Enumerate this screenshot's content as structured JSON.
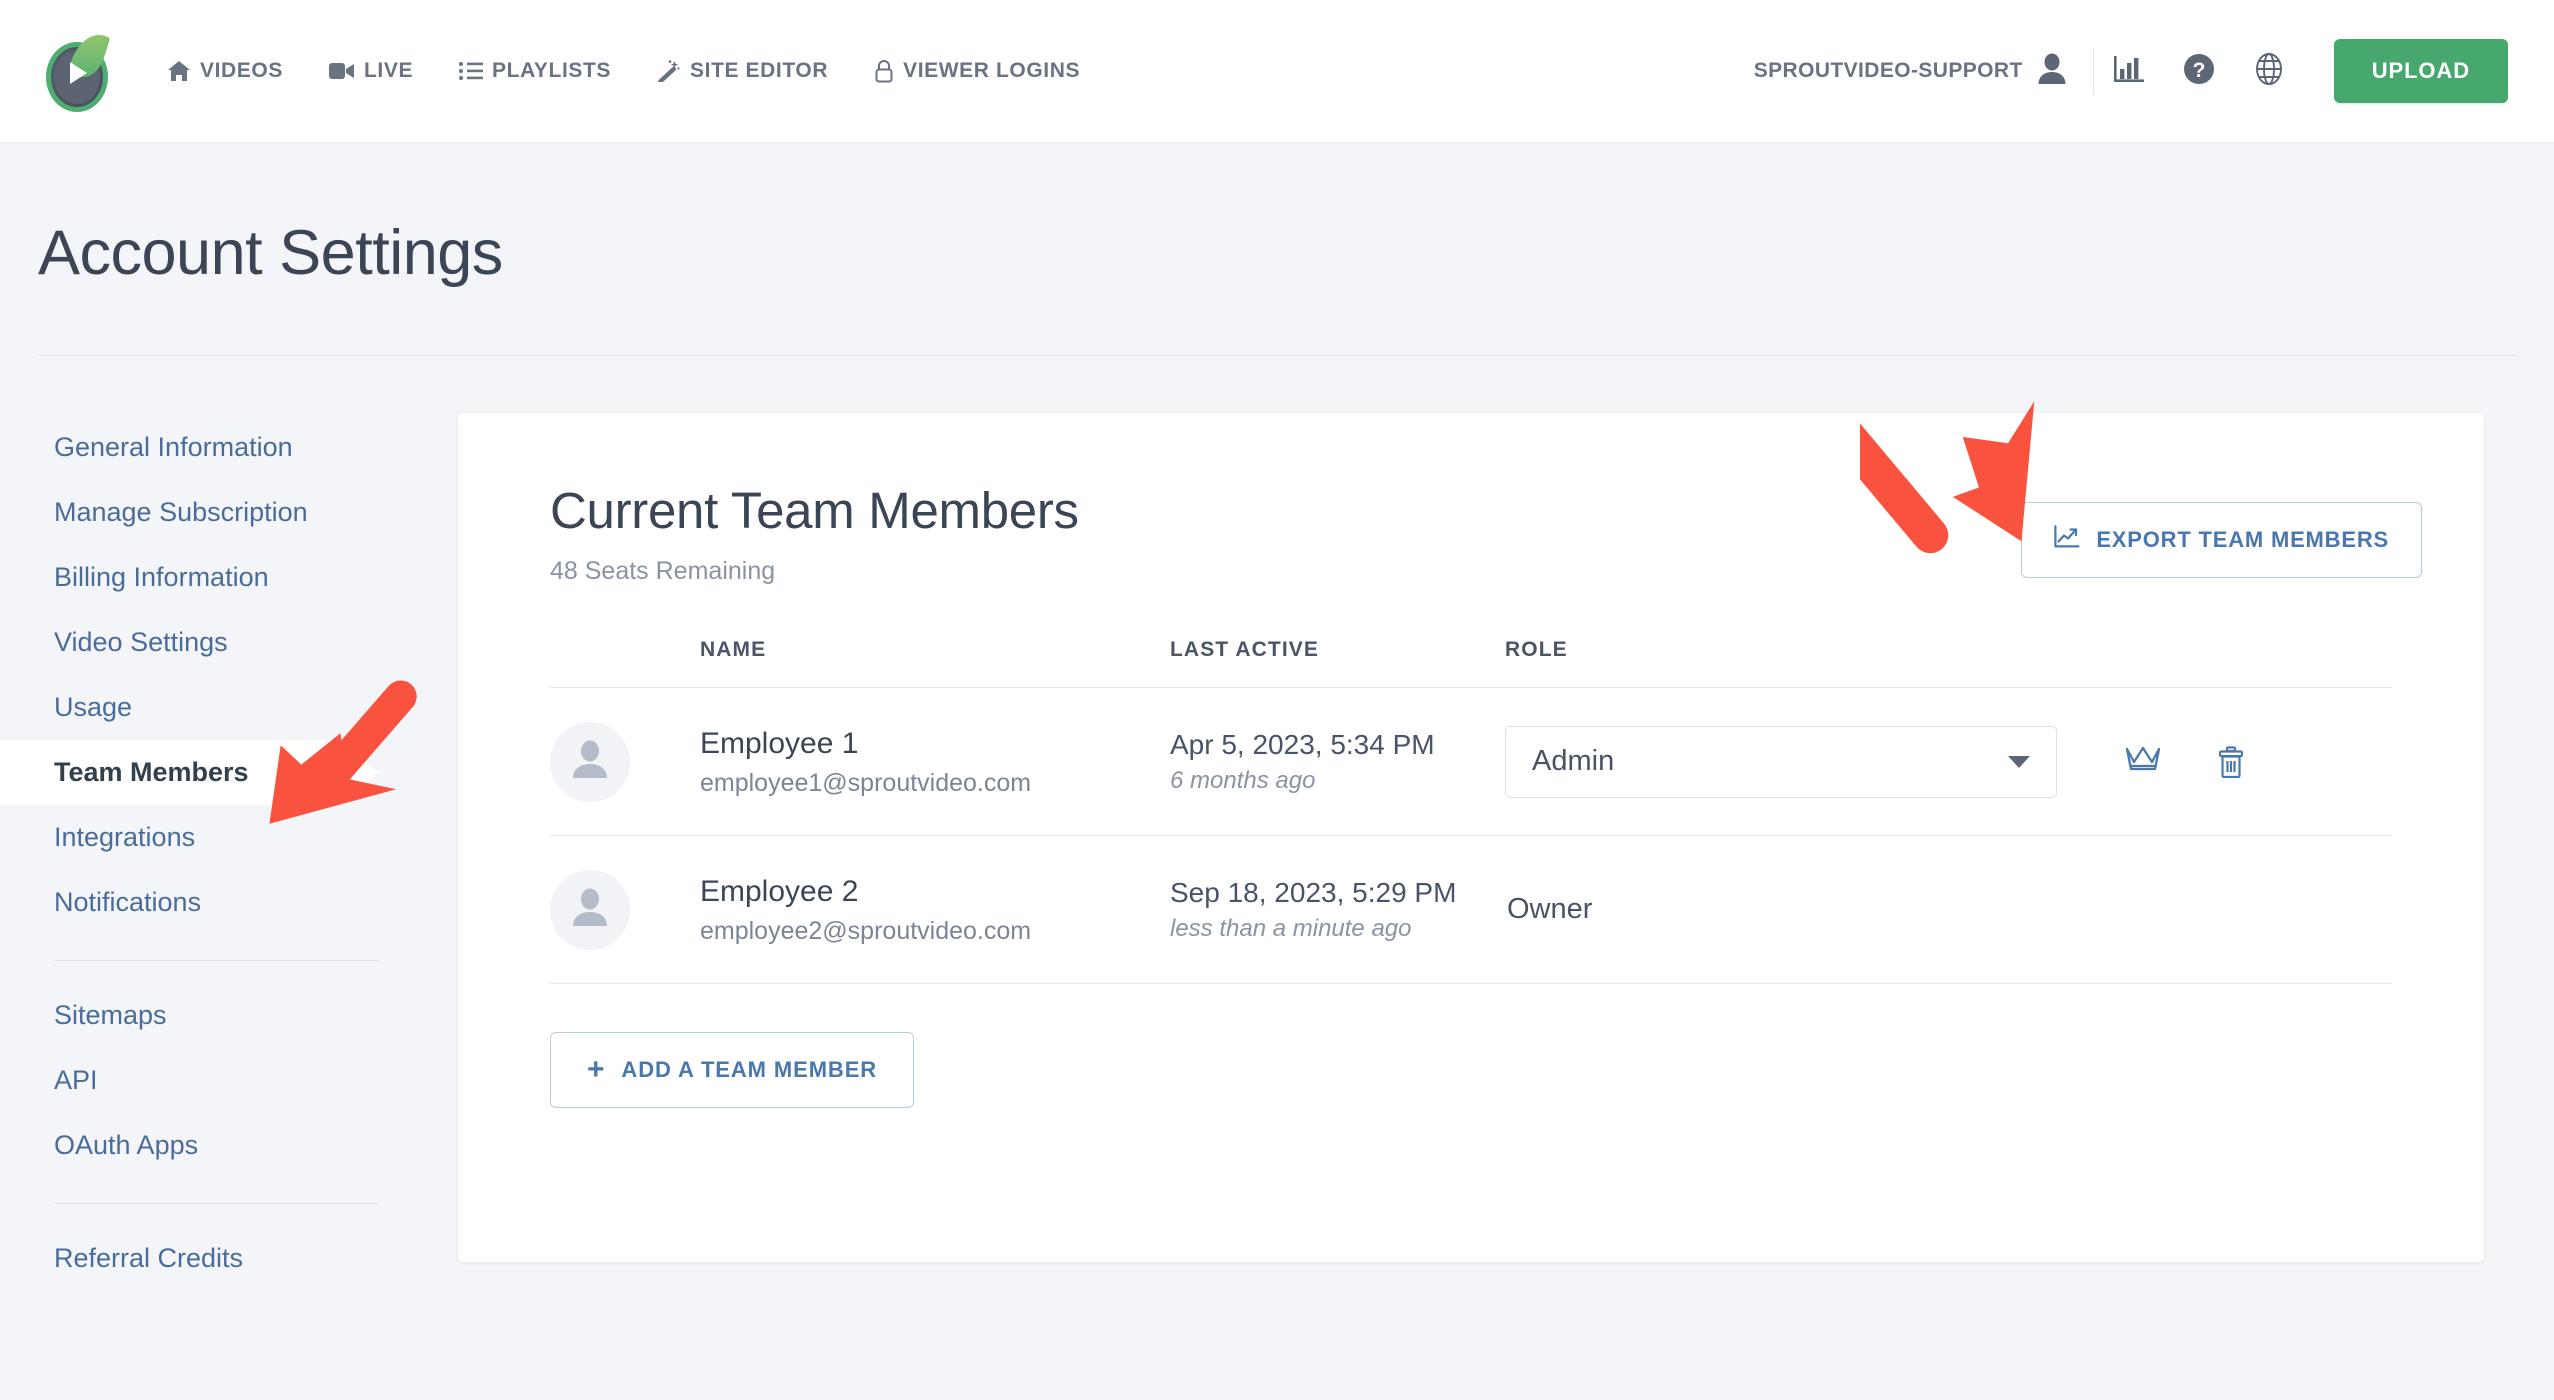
{
  "topnav": {
    "logo_name": "sproutvideo-logo",
    "links": [
      {
        "label": "VIDEOS",
        "icon": "home-icon"
      },
      {
        "label": "LIVE",
        "icon": "video-camera-icon"
      },
      {
        "label": "PLAYLISTS",
        "icon": "list-icon"
      },
      {
        "label": "SITE EDITOR",
        "icon": "magic-wand-icon"
      },
      {
        "label": "VIEWER LOGINS",
        "icon": "lock-icon"
      }
    ],
    "account_name": "SPROUTVIDEO-SUPPORT",
    "account_icon": "user-icon",
    "analytics_icon": "bar-chart-icon",
    "help_icon": "question-circle-icon",
    "globe_icon": "globe-icon",
    "upload_label": "UPLOAD",
    "upload_color": "#46a86d"
  },
  "page": {
    "title": "Account Settings"
  },
  "sidebar": {
    "groups": [
      {
        "items": [
          {
            "label": "General Information",
            "active": false
          },
          {
            "label": "Manage Subscription",
            "active": false
          },
          {
            "label": "Billing Information",
            "active": false
          },
          {
            "label": "Video Settings",
            "active": false
          },
          {
            "label": "Usage",
            "active": false
          },
          {
            "label": "Team Members",
            "active": true
          },
          {
            "label": "Integrations",
            "active": false
          },
          {
            "label": "Notifications",
            "active": false
          }
        ]
      },
      {
        "items": [
          {
            "label": "Sitemaps",
            "active": false
          },
          {
            "label": "API",
            "active": false
          },
          {
            "label": "OAuth Apps",
            "active": false
          }
        ]
      },
      {
        "items": [
          {
            "label": "Referral Credits",
            "active": false
          }
        ]
      }
    ]
  },
  "card": {
    "title": "Current Team Members",
    "subtitle": "48 Seats Remaining",
    "export_label": "EXPORT TEAM MEMBERS",
    "export_icon": "line-chart-icon",
    "add_label": "ADD A TEAM MEMBER",
    "add_icon": "plus-icon",
    "columns": [
      "NAME",
      "LAST ACTIVE",
      "ROLE"
    ],
    "rows": [
      {
        "avatar_icon": "user-placeholder-icon",
        "name": "Employee 1",
        "email": "employee1@sproutvideo.com",
        "last_active": "Apr 5, 2023, 5:34 PM",
        "last_active_relative": "6 months ago",
        "role": "Admin",
        "role_is_select": true,
        "actions": [
          {
            "icon": "crown-icon",
            "name": "make-owner-button"
          },
          {
            "icon": "trash-icon",
            "name": "delete-member-button"
          }
        ]
      },
      {
        "avatar_icon": "user-placeholder-icon",
        "name": "Employee 2",
        "email": "employee2@sproutvideo.com",
        "last_active": "Sep 18, 2023, 5:29 PM",
        "last_active_relative": "less than a minute ago",
        "role": "Owner",
        "role_is_select": false,
        "actions": []
      }
    ]
  },
  "annotations": {
    "color": "#f9533f",
    "arrows": [
      {
        "name": "arrow-pointing-export-button",
        "direction": "down-right"
      },
      {
        "name": "arrow-pointing-team-members-nav",
        "direction": "down-left"
      }
    ]
  }
}
